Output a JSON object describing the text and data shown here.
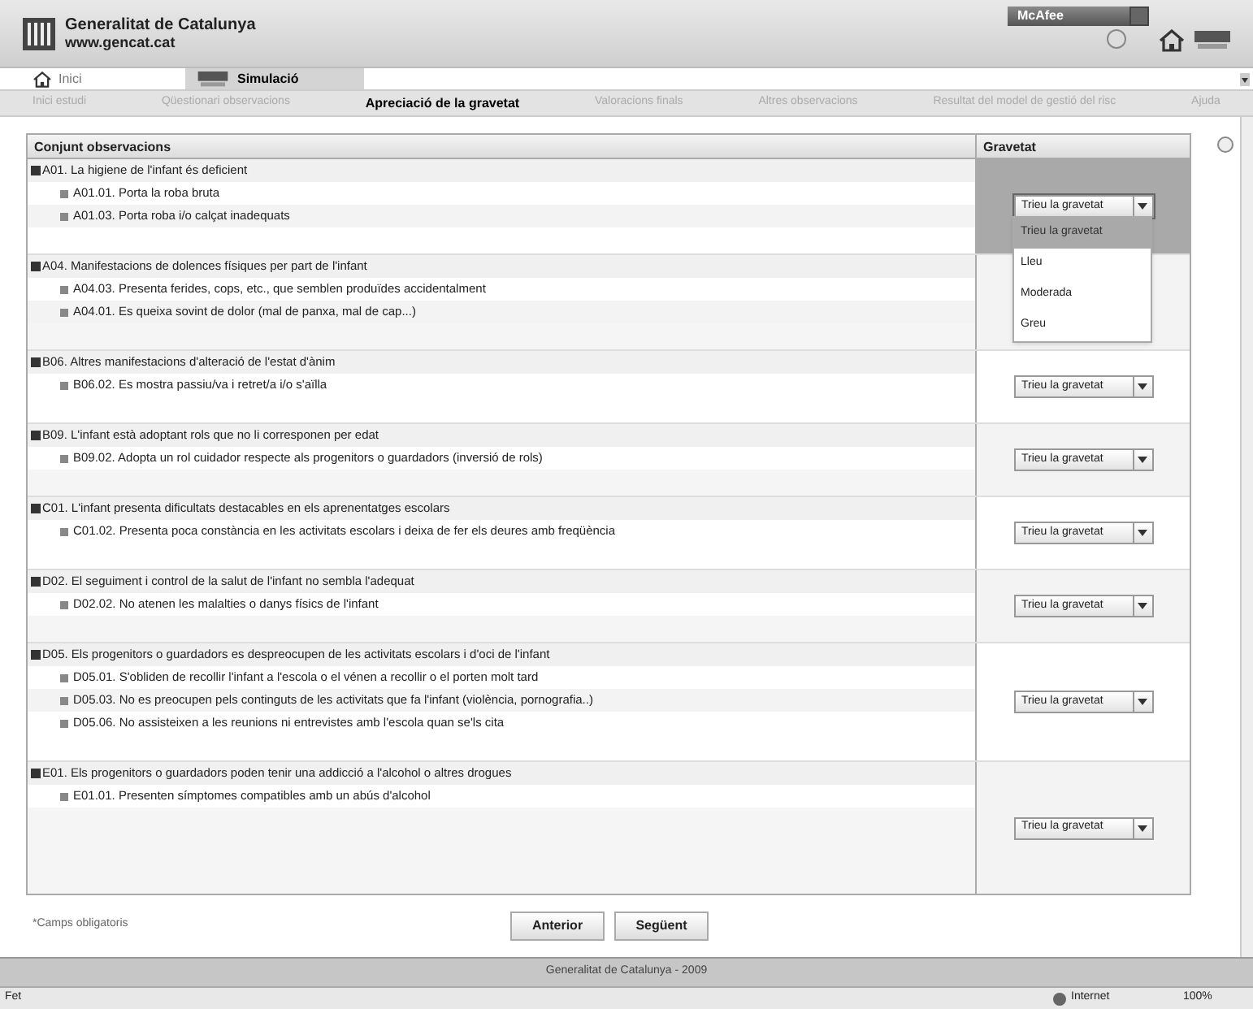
{
  "site": {
    "name": "Generalitat de Catalunya",
    "url": "www.gencat.cat"
  },
  "toolbar": {
    "badge": "McAfee"
  },
  "tabs": [
    {
      "label": "Inici",
      "selected": false
    },
    {
      "label": "Simulació",
      "selected": true
    }
  ],
  "steps": [
    {
      "label": "Inici estudi",
      "selected": false
    },
    {
      "label": "Qüestionari observacions",
      "selected": false
    },
    {
      "label": "Apreciació de la gravetat",
      "selected": true
    },
    {
      "label": "Valoracions finals",
      "selected": false
    },
    {
      "label": "Altres observacions",
      "selected": false
    },
    {
      "label": "Resultat del model de gestió del risc",
      "selected": false
    },
    {
      "label": "Ajuda",
      "selected": false
    }
  ],
  "table": {
    "columns": [
      "Conjunt observacions",
      "Gravetat"
    ],
    "groups": [
      {
        "title": "A01. La higiene de l'infant és deficient",
        "items": [
          "A01.01. Porta la roba bruta",
          "A01.03. Porta roba i/o calçat inadequats"
        ],
        "severity": "Trieu la gravetat",
        "highlighted": true,
        "open": true
      },
      {
        "title": "A04. Manifestacions de dolences físiques per part de l'infant",
        "items": [
          "A04.03. Presenta ferides, cops, etc., que semblen produïdes accidentalment",
          "A04.01. Es queixa sovint de dolor (mal de panxa, mal de cap...)"
        ],
        "highlighted": false
      },
      {
        "title": "B06. Altres manifestacions d'alteració de l'estat d'ànim",
        "items": [
          "B06.02. Es mostra passiu/va i retret/a i/o s'aïlla"
        ],
        "severity": "Trieu la gravetat",
        "highlighted": false,
        "open": false
      },
      {
        "title": "B09. L'infant està adoptant rols que no li corresponen per edat",
        "items": [
          "B09.02. Adopta un rol cuidador respecte als progenitors o guardadors (inversió de rols)"
        ],
        "severity": "Trieu la gravetat",
        "highlighted": false,
        "open": false
      },
      {
        "title": "C01. L'infant presenta dificultats destacables en els aprenentatges escolars",
        "items": [
          "C01.02. Presenta poca constància en les activitats escolars i deixa de fer els deures amb freqüència"
        ],
        "severity": "Trieu la gravetat",
        "highlighted": false,
        "open": false
      },
      {
        "title": "D02. El seguiment i control de la salut de l'infant no sembla l'adequat",
        "items": [
          "D02.02. No atenen les malalties o danys físics de l'infant"
        ],
        "severity": "Trieu la gravetat",
        "highlighted": false,
        "open": false
      },
      {
        "title": "D05. Els progenitors o guardadors es despreocupen de les activitats escolars i d'oci de l'infant",
        "items": [
          "D05.01. S'obliden de recollir l'infant a l'escola o el vénen a recollir o el porten molt tard",
          "D05.03. No es preocupen pels continguts de les activitats que fa l'infant (violència, pornografia..)",
          "D05.06. No assisteixen a les reunions ni entrevistes amb l'escola quan se'ls cita"
        ],
        "severity": "Trieu la gravetat",
        "highlighted": false,
        "open": false
      },
      {
        "title": "E01. Els progenitors o guardadors poden tenir una addicció a l'alcohol o altres drogues",
        "items": [
          "E01.01. Presenten símptomes compatibles amb un abús d'alcohol"
        ],
        "severity": "Trieu la gravetat",
        "highlighted": false,
        "open": false
      }
    ]
  },
  "dropdown_options": [
    {
      "label": "Trieu la gravetat",
      "selected": true
    },
    {
      "label": "Lleu",
      "selected": false
    },
    {
      "label": "Moderada",
      "selected": false
    },
    {
      "label": "Greu",
      "selected": false
    }
  ],
  "required_note": "*Camps obligatoris",
  "buttons": [
    "Anterior",
    "Següent"
  ],
  "footer": "Generalitat de Catalunya - 2009",
  "status_bar": {
    "left": "Fet",
    "zone": "Internet",
    "zoom": "100%"
  }
}
